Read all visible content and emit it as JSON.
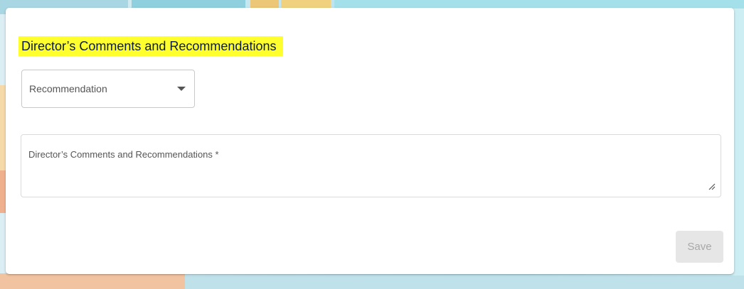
{
  "section": {
    "title": "Director’s Comments and Recommendations"
  },
  "recommendation_select": {
    "label": "Recommendation",
    "caret_icon": "caret-down-icon"
  },
  "comments_field": {
    "label": "Director’s Comments and Recommendations *",
    "value": "",
    "resize_icon": "resize-handle-icon"
  },
  "actions": {
    "save_label": "Save"
  },
  "colors": {
    "highlight": "#ffff2e",
    "title_text": "#0a1a4a",
    "button_disabled_bg": "#e6e6e6",
    "button_disabled_text": "#a8a8a8"
  }
}
